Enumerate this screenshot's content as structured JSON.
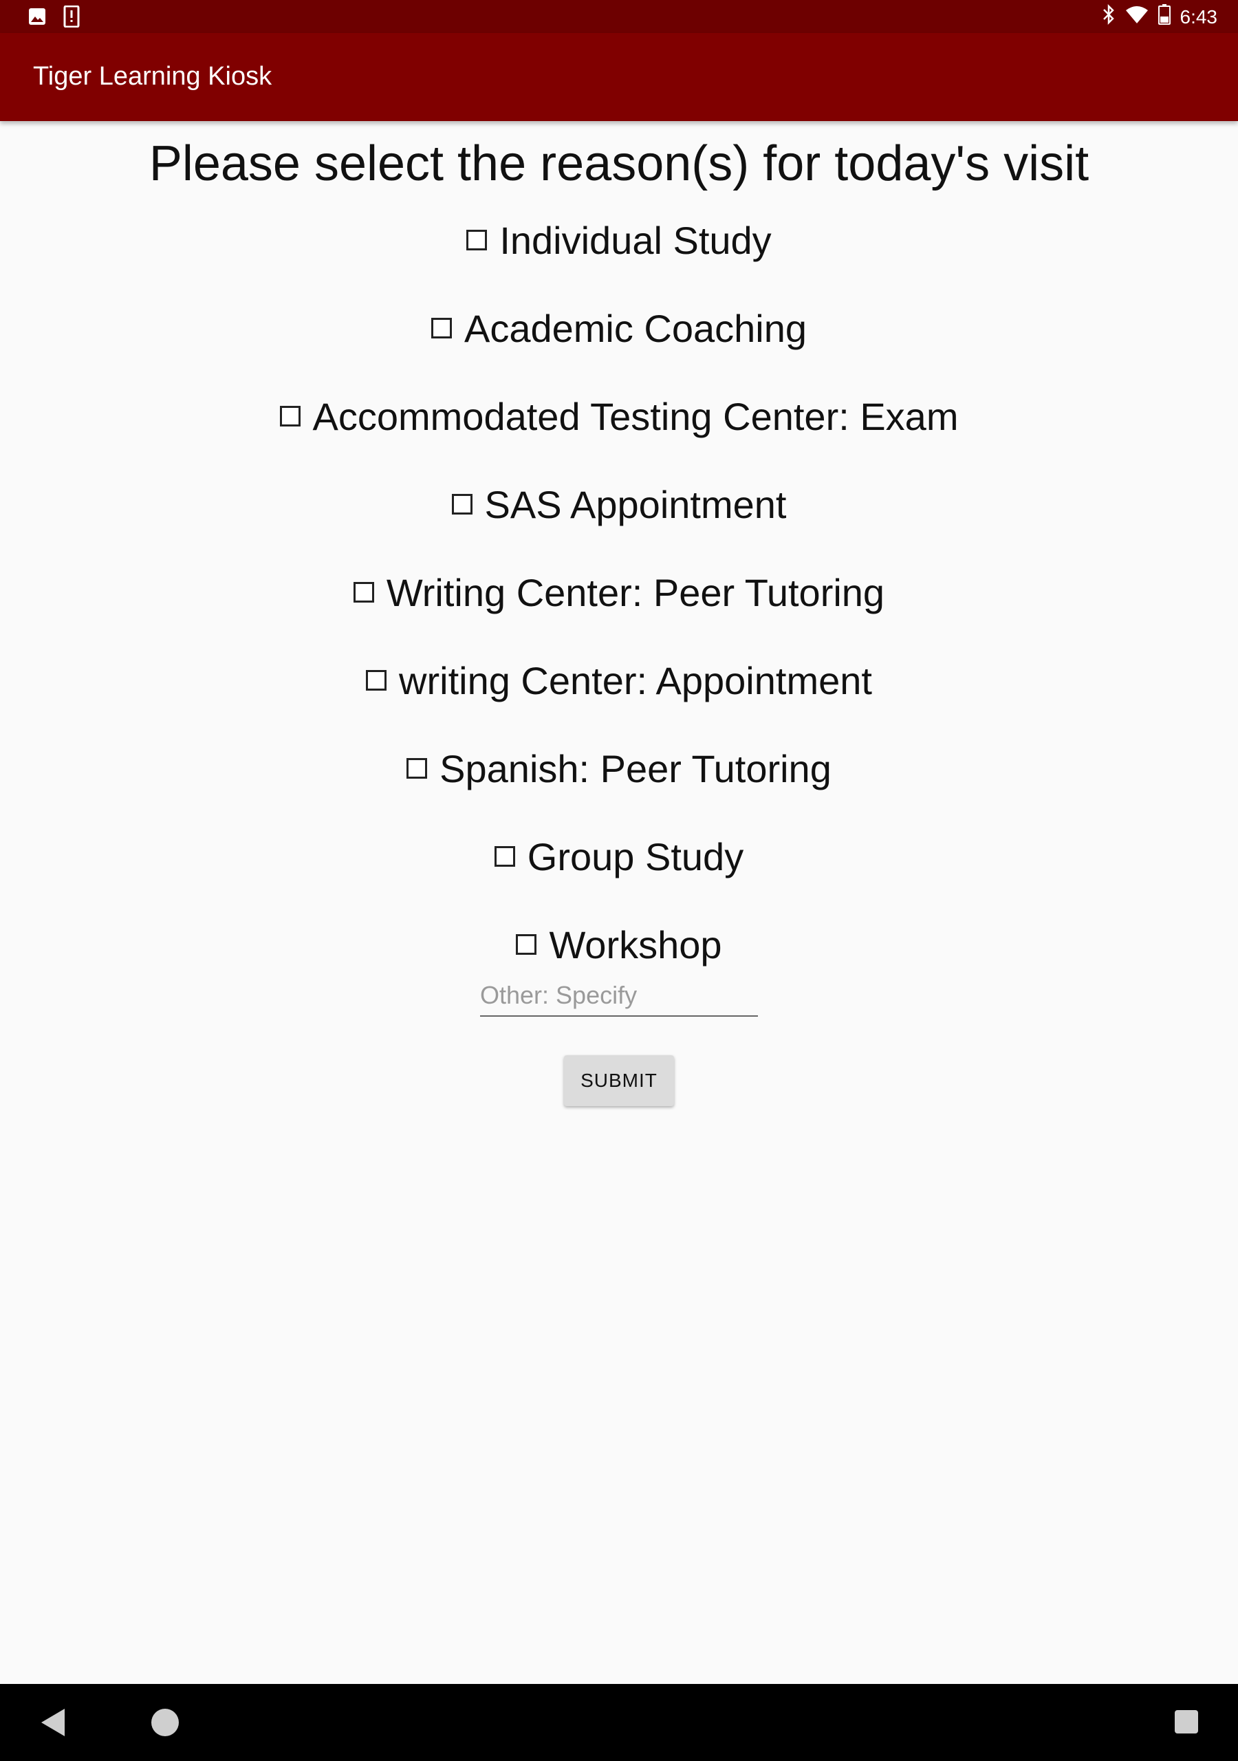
{
  "status_bar": {
    "time": "6:43",
    "left_icons": [
      "image-icon",
      "alert-icon"
    ],
    "right_icons": [
      "bluetooth-icon",
      "wifi-icon",
      "battery-icon"
    ]
  },
  "app_bar": {
    "title": "Tiger Learning Kiosk",
    "color": "#800000"
  },
  "form": {
    "heading": "Please select the reason(s) for today's visit",
    "options": [
      {
        "label": "Individual Study",
        "checked": false
      },
      {
        "label": "Academic Coaching",
        "checked": false
      },
      {
        "label": "Accommodated Testing Center: Exam",
        "checked": false
      },
      {
        "label": "SAS Appointment",
        "checked": false
      },
      {
        "label": "Writing Center: Peer Tutoring",
        "checked": false
      },
      {
        "label": "writing Center: Appointment",
        "checked": false
      },
      {
        "label": "Spanish: Peer Tutoring",
        "checked": false
      },
      {
        "label": "Group Study",
        "checked": false
      },
      {
        "label": "Workshop",
        "checked": false
      }
    ],
    "other_placeholder": "Other: Specify",
    "other_value": "",
    "submit_label": "SUBMIT"
  },
  "nav_bar": {
    "icons": [
      "back-icon",
      "home-icon",
      "recents-icon"
    ]
  }
}
